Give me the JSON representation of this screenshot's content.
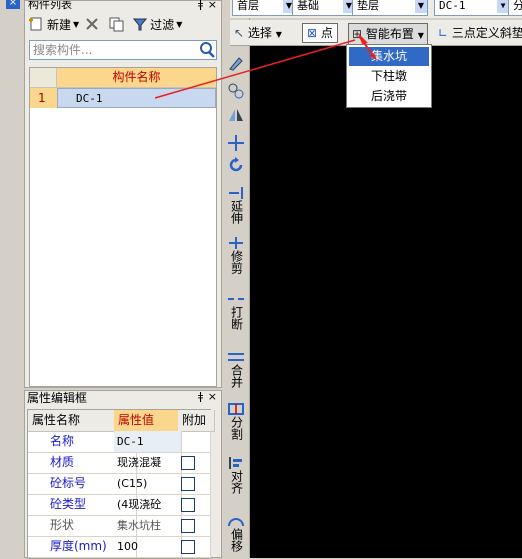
{
  "component_list": {
    "title": "构件列表",
    "pin": "ǂ",
    "close": "×",
    "new_label": "新建",
    "filter_label": "过滤",
    "search_placeholder": "搜索构件...",
    "column_header": "构件名称",
    "rows": [
      {
        "num": "1",
        "name": "DC-1"
      }
    ]
  },
  "left_strip": {
    "close": "×"
  },
  "property_panel": {
    "title": "属性编辑框",
    "pin": "ǂ",
    "close": "×",
    "headers": {
      "name": "属性名称",
      "value": "属性值",
      "extra": "附加"
    },
    "rows": [
      {
        "name": "名称",
        "value": "DC-1",
        "checkbox": false
      },
      {
        "name": "材质",
        "value": "现浇混凝",
        "checkbox": true
      },
      {
        "name": "砼标号",
        "value": "(C15)",
        "checkbox": true
      },
      {
        "name": "砼类型",
        "value": "(4现浇砼",
        "checkbox": true
      },
      {
        "name": "形状",
        "value": "集水坑柱",
        "checkbox": true
      },
      {
        "name": "厚度(mm)",
        "value": "100",
        "checkbox": true
      }
    ]
  },
  "vertical_tools": {
    "extend": "延伸",
    "trim": "修剪",
    "break": "打断",
    "merge": "合并",
    "split": "分割",
    "align": "对齐",
    "offset": "偏移"
  },
  "top_toolbar": {
    "floor": "首层",
    "category": "基础",
    "type": "垫层",
    "component": "DC-1",
    "extra": "分"
  },
  "draw_toolbar": {
    "select": "选择",
    "point": "点",
    "smart": "智能布置",
    "three_point": "三点定义斜垫"
  },
  "smart_menu": {
    "items": [
      "集水坑",
      "下柱墩",
      "后浇带"
    ],
    "selected_index": 0
  }
}
